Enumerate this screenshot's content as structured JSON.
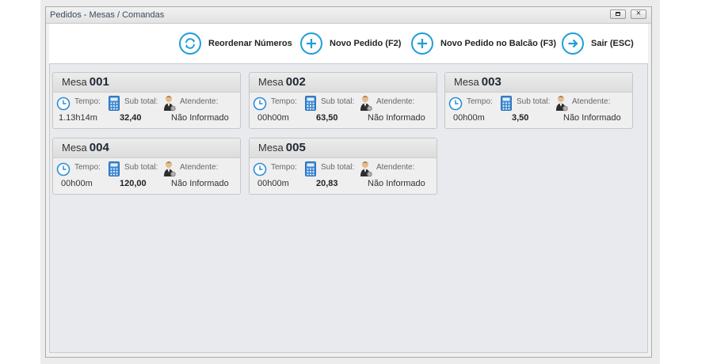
{
  "window": {
    "title": "Pedidos - Mesas / Comandas",
    "close_symbol": "×"
  },
  "toolbar": {
    "buttons": [
      {
        "label": "Reordenar Números",
        "icon": "refresh-icon"
      },
      {
        "label": "Novo Pedido (F2)",
        "icon": "plus-icon"
      },
      {
        "label": "Novo Pedido no Balcão (F3)",
        "icon": "plus-icon"
      },
      {
        "label": "Sair (ESC)",
        "icon": "arrow-right-icon"
      }
    ]
  },
  "labels": {
    "mesa": "Mesa",
    "tempo": "Tempo:",
    "subtotal": "Sub total:",
    "atendente": "Atendente:"
  },
  "tables": [
    {
      "number": "001",
      "time": "1.13h14m",
      "subtotal": "32,40",
      "attendant": "Não Informado"
    },
    {
      "number": "002",
      "time": "00h00m",
      "subtotal": "63,50",
      "attendant": "Não Informado"
    },
    {
      "number": "003",
      "time": "00h00m",
      "subtotal": "3,50",
      "attendant": "Não Informado"
    },
    {
      "number": "004",
      "time": "00h00m",
      "subtotal": "120,00",
      "attendant": "Não Informado"
    },
    {
      "number": "005",
      "time": "00h00m",
      "subtotal": "20,83",
      "attendant": "Não Informado"
    }
  ],
  "colors": {
    "accent": "#1e9ed8",
    "clock": "#2a8fd6",
    "calculator": "#3d86d1"
  }
}
